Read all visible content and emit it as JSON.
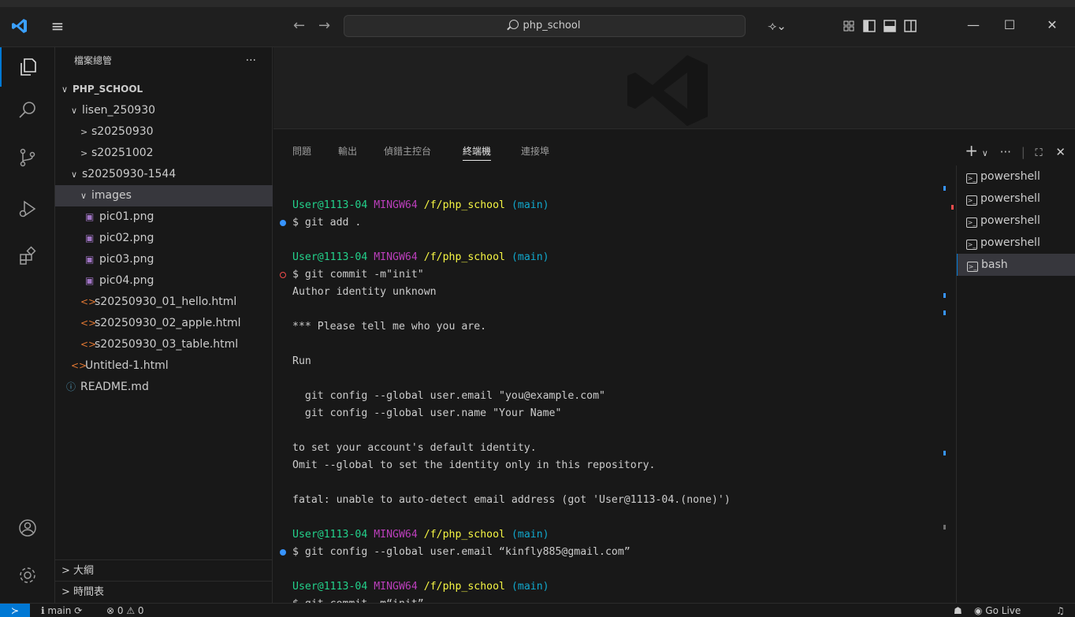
{
  "titlebar": {
    "search_text": "php_school",
    "back": "←",
    "forward": "→"
  },
  "activity": [
    "explorer-icon",
    "search-icon",
    "source-control-icon",
    "run-debug-icon",
    "extensions-icon",
    "account-icon",
    "settings-gear-icon"
  ],
  "sidebar": {
    "title": "檔案總管",
    "more": "···",
    "root": "PHP_SCHOOL",
    "items": [
      {
        "label": "lisen_250930",
        "twisty": "∨"
      },
      {
        "label": "s20250930",
        "twisty": ">"
      },
      {
        "label": "s20251002",
        "twisty": ">"
      },
      {
        "label": "s20250930-1544",
        "twisty": "∨"
      },
      {
        "label": "images",
        "twisty": "∨"
      },
      {
        "label": "pic01.png"
      },
      {
        "label": "pic02.png"
      },
      {
        "label": "pic03.png"
      },
      {
        "label": "pic04.png"
      },
      {
        "label": "s20250930_01_hello.html"
      },
      {
        "label": "s20250930_02_apple.html"
      },
      {
        "label": "s20250930_03_table.html"
      },
      {
        "label": "Untitled-1.html"
      },
      {
        "label": "README.md"
      }
    ],
    "outline": "大綱",
    "timeline": "時間表"
  },
  "panel": {
    "tabs": [
      "問題",
      "輸出",
      "偵錯主控台",
      "終端機",
      "連接埠"
    ],
    "active_tab": "終端機",
    "terminals": [
      "powershell",
      "powershell",
      "powershell",
      "powershell",
      "bash"
    ]
  },
  "terminal": {
    "user": "User@1113-04",
    "ming": "MINGW64",
    "path": "/f/php_school",
    "branch": "(main)",
    "cmd1": "$ git add .",
    "cmd2": "$ git commit -m\"init\"",
    "out1": "Author identity unknown",
    "out2": "*** Please tell me who you are.",
    "out3": "Run",
    "out4": "  git config --global user.email \"you@example.com\"",
    "out5": "  git config --global user.name \"Your Name\"",
    "out6": "to set your account's default identity.",
    "out7": "Omit --global to set the identity only in this repository.",
    "out8": "fatal: unable to auto-detect email address (got 'User@1113-04.(none)')",
    "cmd3": "$ git config --global user.email “kinfly885@gmail.com”",
    "cmd4": "$ git commit -m“init”"
  },
  "statusbar": {
    "branch": "main",
    "errors": "⊗ 0 ⚠ 0",
    "golive": "Go Live"
  },
  "colors": {
    "accent": "#0078d4",
    "user": "#23d18b",
    "mingw": "#bc3fbc",
    "path": "#f5f543",
    "branch": "#11a8cd"
  }
}
